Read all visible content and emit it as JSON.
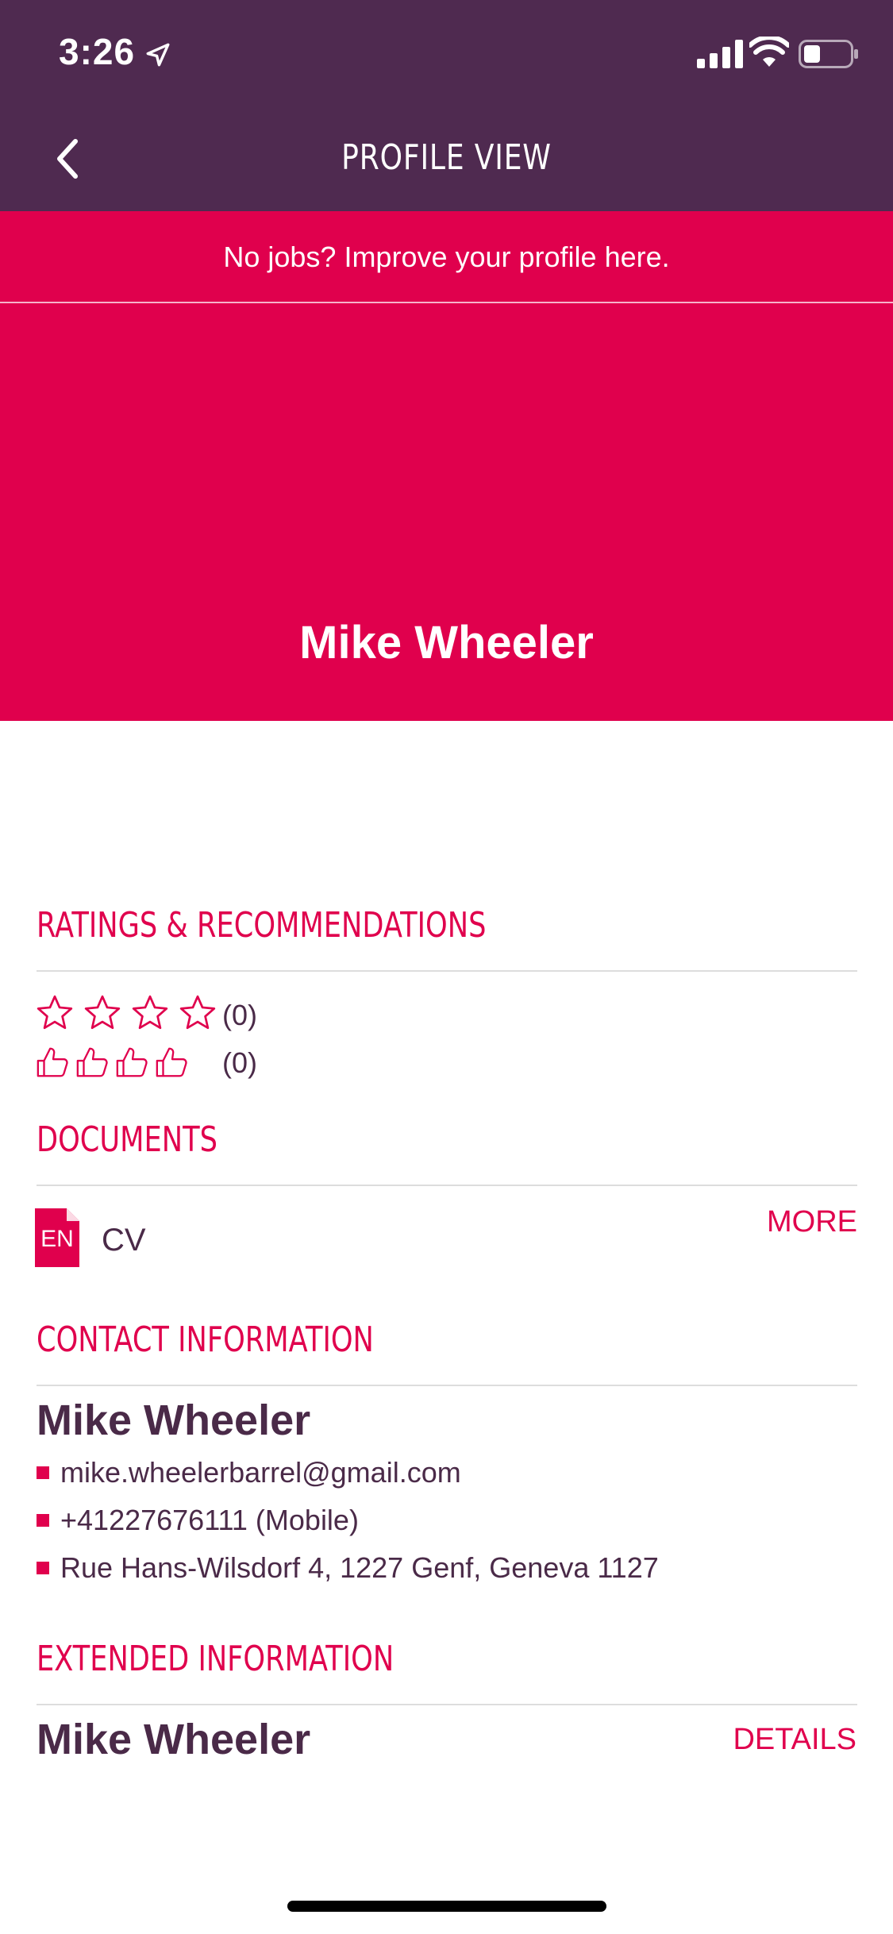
{
  "status_bar": {
    "time": "3:26"
  },
  "nav": {
    "title": "PROFILE VIEW"
  },
  "banner": {
    "text": "No jobs? Improve your profile here."
  },
  "profile": {
    "name": "Mike Wheeler"
  },
  "ratings": {
    "title": "RATINGS & RECOMMENDATIONS",
    "stars": 0,
    "stars_count": "(0)",
    "thumbs": 0,
    "thumbs_count": "(0)"
  },
  "documents": {
    "title": "DOCUMENTS",
    "items": [
      {
        "lang": "EN",
        "name": "CV"
      }
    ],
    "more_label": "MORE"
  },
  "contact": {
    "title": "CONTACT INFORMATION",
    "name": "Mike Wheeler",
    "email": "mike.wheelerbarrel@gmail.com",
    "phone": "+41227676111 (Mobile)",
    "address": "Rue Hans-Wilsdorf 4, 1227 Genf, Geneva 1127"
  },
  "extended": {
    "title": "EXTENDED INFORMATION",
    "name": "Mike Wheeler",
    "details_label": "DETAILS"
  },
  "colors": {
    "brand_purple": "#4f2a50",
    "brand_red": "#e0004d",
    "text_dark": "#4a2a48"
  }
}
